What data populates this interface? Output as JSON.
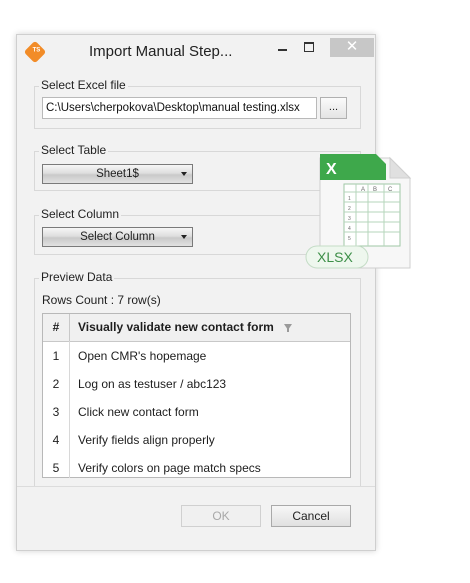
{
  "window": {
    "title": "Import Manual Step...",
    "icon_text": "TS",
    "minimize_icon": "minimize-icon",
    "maximize_icon": "maximize-icon",
    "close_label": "✕"
  },
  "excel": {
    "label": "Select Excel file",
    "path": "C:\\Users\\cherpokova\\Desktop\\manual testing.xlsx",
    "browse_label": "..."
  },
  "table_select": {
    "label": "Select Table",
    "value": "Sheet1$"
  },
  "column_select": {
    "label": "Select Column",
    "value": "Select Column"
  },
  "preview": {
    "label": "Preview Data",
    "rows_count": "Rows Count : 7 row(s)",
    "columns": [
      "#",
      "Visually validate new contact form"
    ],
    "rows": [
      {
        "num": "1",
        "text": "Open CMR's hopemage"
      },
      {
        "num": "2",
        "text": "Log on as testuser / abc123"
      },
      {
        "num": "3",
        "text": "Click new contact form"
      },
      {
        "num": "4",
        "text": "Verify fields align properly"
      },
      {
        "num": "5",
        "text": "Verify colors on page match specs"
      }
    ]
  },
  "footer": {
    "ok_label": "OK",
    "cancel_label": "Cancel"
  },
  "xlsx_icon": {
    "badge": "XLSX",
    "columns": [
      "A",
      "B",
      "C"
    ],
    "rows": [
      "1",
      "2",
      "3",
      "4",
      "5"
    ],
    "accent": "#2f9e44"
  },
  "colors": {
    "accent_orange": "#f28c28",
    "window_bg": "#f2f2f2"
  }
}
